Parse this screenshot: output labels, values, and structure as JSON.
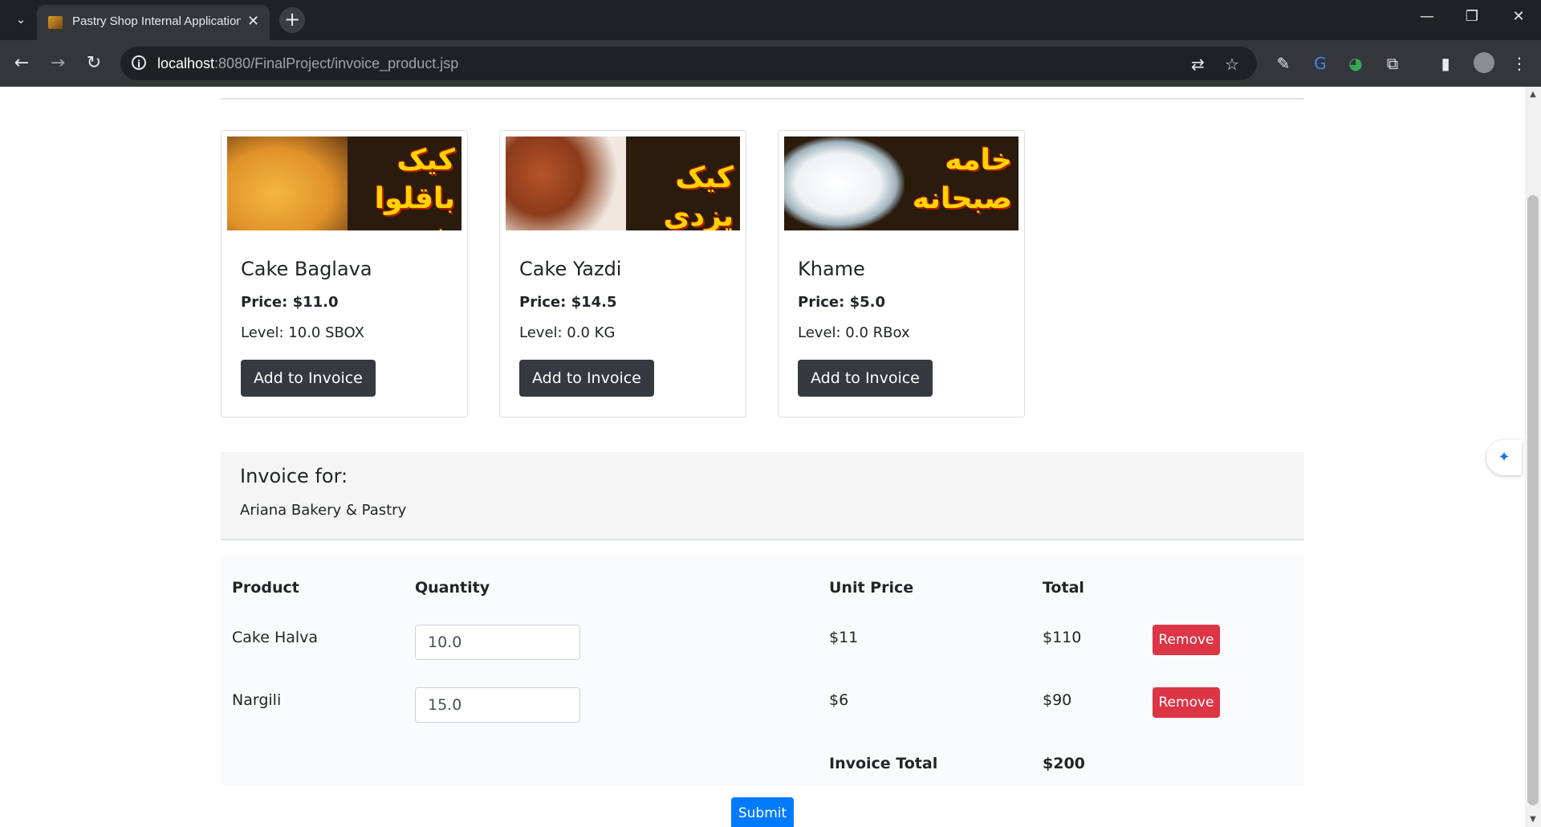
{
  "browser": {
    "tab_title": "Pastry Shop Internal Application",
    "tab_close": "✕",
    "new_tab": "+",
    "url_host": "localhost",
    "url_rest": ":8080/FinalProject/invoice_product.jsp"
  },
  "products": [
    {
      "name": "Cake Baglava",
      "price": "Price: $11.0",
      "level": "Level: 10.0 SBOX",
      "button": "Add to Invoice",
      "banner_text": "کیک باقلوا شربتی",
      "image_color": "#e8a63a"
    },
    {
      "name": "Cake Yazdi",
      "price": "Price: $14.5",
      "level": "Level: 0.0 KG",
      "button": "Add to Invoice",
      "banner_text": "کیک یزدی",
      "image_color": "#8b3b1a"
    },
    {
      "name": "Khame",
      "price": "Price: $5.0",
      "level": "Level: 0.0 RBox",
      "button": "Add to Invoice",
      "banner_text": "خامه صبحانه",
      "image_color": "#f2f2f2"
    }
  ],
  "invoice": {
    "title": "Invoice for:",
    "customer": "Ariana Bakery & Pastry",
    "headers": {
      "product": "Product",
      "quantity": "Quantity",
      "unit_price": "Unit Price",
      "total": "Total"
    },
    "rows": [
      {
        "product": "Cake Halva",
        "quantity": "10.0",
        "unit_price": "$11",
        "total": "$110",
        "remove": "Remove"
      },
      {
        "product": "Nargili",
        "quantity": "15.0",
        "unit_price": "$6",
        "total": "$90",
        "remove": "Remove"
      }
    ],
    "total_label": "Invoice Total",
    "total_value": "$200",
    "submit": "Submit"
  }
}
